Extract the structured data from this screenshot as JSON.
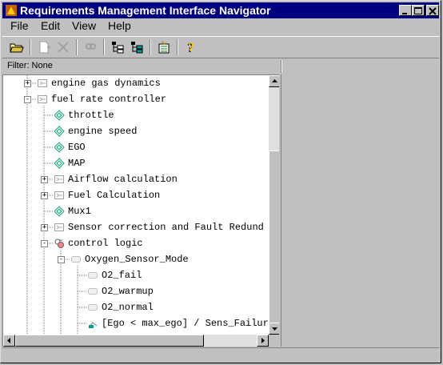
{
  "window": {
    "title": "Requirements Management Interface Navigator",
    "title_bar_color": "#000080"
  },
  "menu": {
    "file": "File",
    "edit": "Edit",
    "view": "View",
    "help": "Help"
  },
  "toolbar": {
    "tools": [
      "open-folder-icon",
      "new-item-icon",
      "delete-icon",
      "find-icon",
      "tree-expand-icon",
      "tree-collapse-icon",
      "properties-icon",
      "help-icon"
    ]
  },
  "filter": {
    "label": "Filter: None"
  },
  "tree": {
    "nodes": [
      {
        "label": "engine  gas dynamics",
        "icon": "subsystem-icon",
        "expander": "+"
      },
      {
        "label": "fuel rate controller",
        "icon": "subsystem-icon",
        "expander": "-"
      },
      {
        "label": "throttle",
        "icon": "port-icon"
      },
      {
        "label": "engine speed",
        "icon": "port-icon"
      },
      {
        "label": "EGO",
        "icon": "port-icon"
      },
      {
        "label": "MAP",
        "icon": "port-icon"
      },
      {
        "label": "Airflow calculation",
        "icon": "subsystem-icon",
        "expander": "+"
      },
      {
        "label": "Fuel  Calculation",
        "icon": "subsystem-icon",
        "expander": "+"
      },
      {
        "label": "Mux1",
        "icon": "port-icon"
      },
      {
        "label": "Sensor correction and  Fault Redund",
        "icon": "subsystem-icon",
        "expander": "+"
      },
      {
        "label": "control logic",
        "icon": "stateflow-icon",
        "expander": "-"
      },
      {
        "label": "Oxygen_Sensor_Mode",
        "icon": "state-icon",
        "expander": "-"
      },
      {
        "label": "O2_fail",
        "icon": "state-icon"
      },
      {
        "label": "O2_warmup",
        "icon": "state-icon"
      },
      {
        "label": "O2_normal",
        "icon": "state-icon"
      },
      {
        "label": "[Ego < max_ego] / Sens_Failur",
        "icon": "transition-icon"
      }
    ]
  }
}
